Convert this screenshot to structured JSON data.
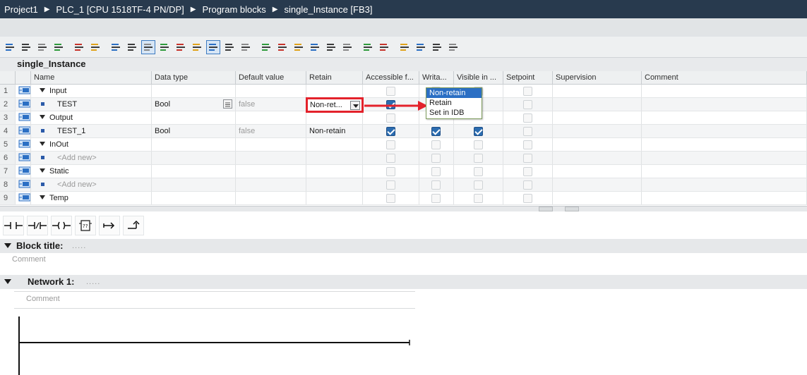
{
  "breadcrumb": [
    "Project1",
    "PLC_1 [CPU 1518TF-4 PN/DP]",
    "Program blocks",
    "single_Instance [FB3]"
  ],
  "block_name": "single_Instance",
  "toolbar_icons": [
    "insert-row-icon",
    "delete-row-icon",
    "expand-icon",
    "collapse-icon",
    "monitor-icon",
    "list-view-icon",
    "detail-view-icon",
    "grid-view-icon",
    "comment-toggle-icon",
    "move-down-icon",
    "move-down-2-icon",
    "sort-icon",
    "select-all-icon",
    "mark-icon",
    "network-insert-icon",
    "network-delete-icon",
    "reference-icon",
    "compile-icon",
    "download-icon",
    "align-left-icon",
    "align-center-icon",
    "indent-icon",
    "bookmark-prev-icon",
    "bookmark-next-icon",
    "compare-icon",
    "snapshot-icon",
    "block-lock-icon"
  ],
  "table": {
    "columns": [
      "Name",
      "Data type",
      "Default value",
      "Retain",
      "Accessible f...",
      "Writa...",
      "Visible in ...",
      "Setpoint",
      "Supervision",
      "Comment"
    ],
    "rows": [
      {
        "num": "1",
        "kind": "section",
        "name": "Input",
        "type": "",
        "default": "",
        "retain": "",
        "acc": "off",
        "wr": "off",
        "vis": "off",
        "set": "off"
      },
      {
        "num": "2",
        "kind": "var",
        "name": "TEST",
        "type": "Bool",
        "default": "false",
        "retain": "",
        "acc": "on",
        "wr": "hidden",
        "vis": "hidden",
        "set": "off"
      },
      {
        "num": "3",
        "kind": "section",
        "name": "Output",
        "type": "",
        "default": "",
        "retain": "",
        "acc": "off",
        "wr": "hidden",
        "vis": "hidden",
        "set": "off"
      },
      {
        "num": "4",
        "kind": "var",
        "name": "TEST_1",
        "type": "Bool",
        "default": "false",
        "retain": "Non-retain",
        "acc": "on",
        "wr": "on",
        "vis": "on",
        "set": "off"
      },
      {
        "num": "5",
        "kind": "section",
        "name": "InOut",
        "type": "",
        "default": "",
        "retain": "",
        "acc": "off",
        "wr": "off",
        "vis": "off",
        "set": "off"
      },
      {
        "num": "6",
        "kind": "add",
        "name": "<Add new>",
        "type": "",
        "default": "",
        "retain": "",
        "acc": "off",
        "wr": "off",
        "vis": "off",
        "set": "off"
      },
      {
        "num": "7",
        "kind": "section",
        "name": "Static",
        "type": "",
        "default": "",
        "retain": "",
        "acc": "off",
        "wr": "off",
        "vis": "off",
        "set": "off"
      },
      {
        "num": "8",
        "kind": "add",
        "name": "<Add new>",
        "type": "",
        "default": "",
        "retain": "",
        "acc": "off",
        "wr": "off",
        "vis": "off",
        "set": "off"
      },
      {
        "num": "9",
        "kind": "section",
        "name": "Temp",
        "type": "",
        "default": "",
        "retain": "",
        "acc": "off",
        "wr": "off",
        "vis": "off",
        "set": "off"
      }
    ]
  },
  "retain_dropdown": {
    "value": "Non-ret...",
    "options": [
      "Non-retain",
      "Retain",
      "Set in IDB"
    ],
    "selected": "Non-retain"
  },
  "annotation_color": "#e3222b",
  "ladder_palette": [
    "normally-open-contact-icon",
    "normally-closed-contact-icon",
    "coil-icon",
    "empty-box-icon",
    "open-branch-icon",
    "close-branch-icon"
  ],
  "block_title": {
    "label": "Block title:",
    "dots": ".....",
    "comment": "Comment"
  },
  "network": {
    "label": "Network 1:",
    "dots": ".....",
    "comment": "Comment"
  }
}
